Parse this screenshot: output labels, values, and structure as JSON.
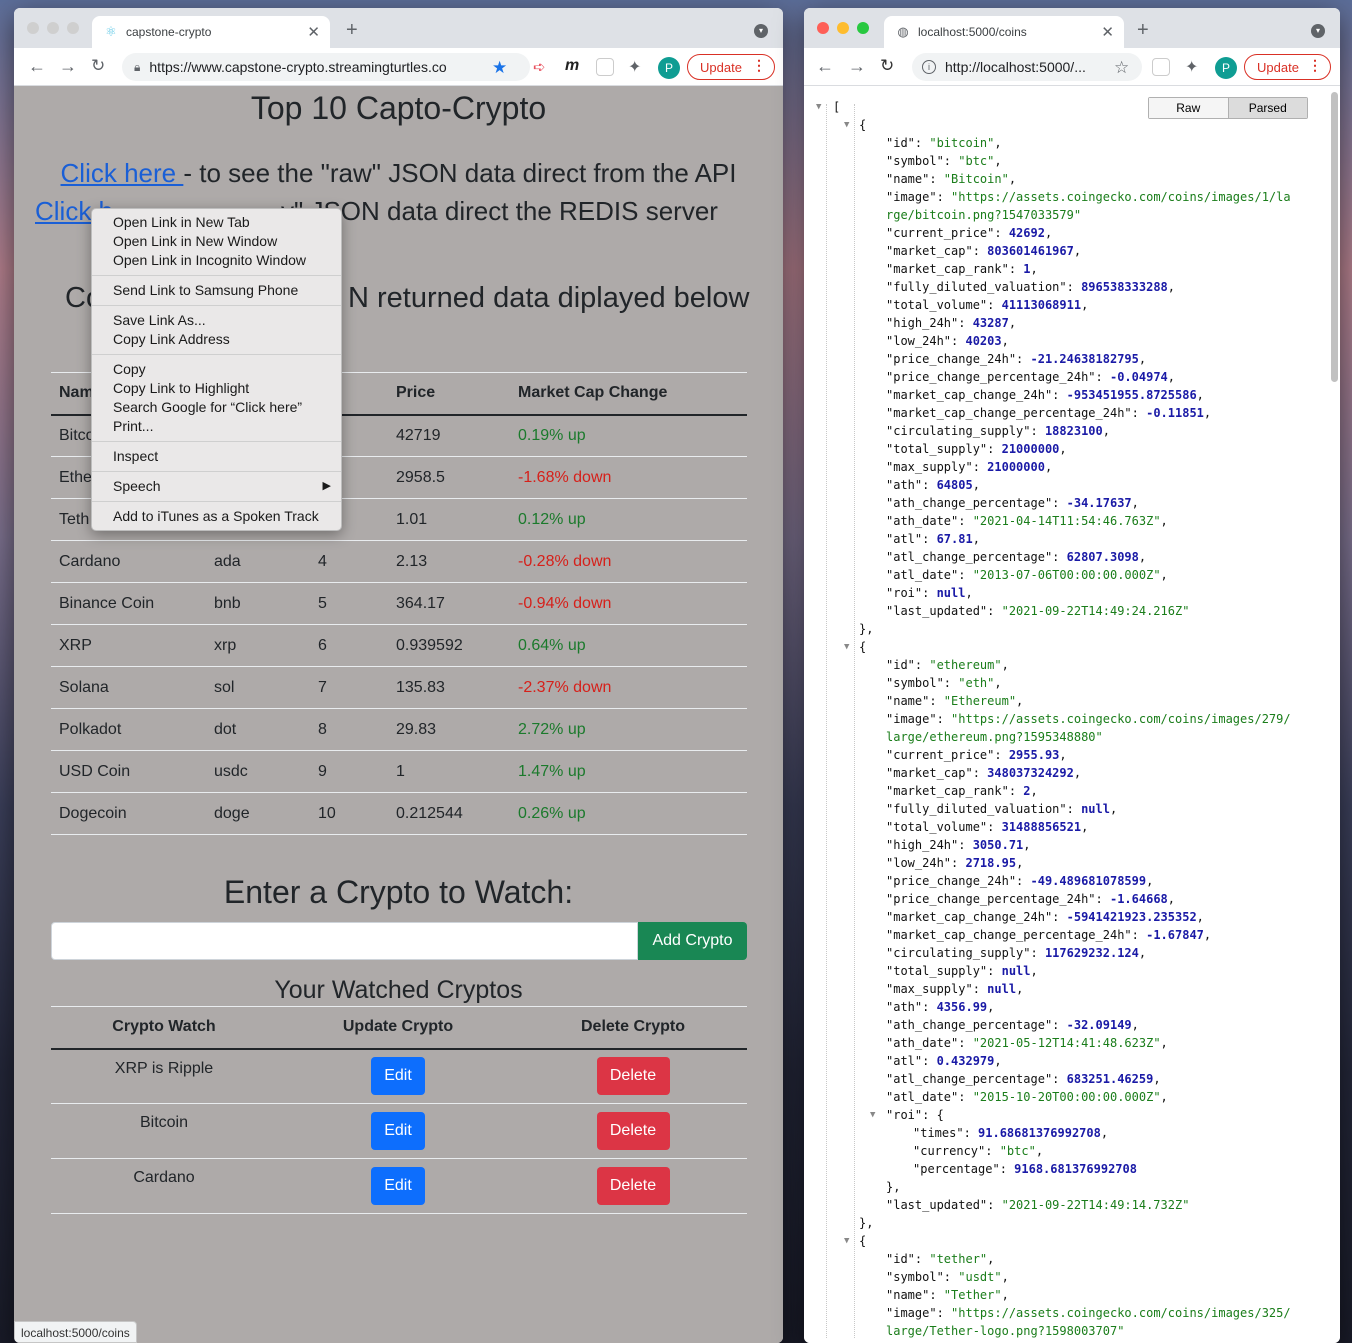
{
  "left_window": {
    "tab_title": "capstone-crypto",
    "url": "https://www.capstone-crypto.streamingturtles.co",
    "update_label": "Update",
    "avatar_letter": "P",
    "page": {
      "title": "Top 10 Capto-Crypto",
      "link1_text": "Click here ",
      "link1_rest": "- to see the \"raw\" JSON data direct from the API",
      "link2_text": "Click h",
      "link2_rest": "y\" JSON data direct the REDIS server",
      "subtitle_left": "Co",
      "subtitle_right": "N returned data diplayed below",
      "market_headers": [
        "Nam",
        "nk",
        "Price",
        "Market Cap Change"
      ],
      "market_rows": [
        {
          "name": "Bitco",
          "symbol": "",
          "rank": "",
          "price": "42719",
          "change": "0.19% up",
          "dir": "up"
        },
        {
          "name": "Ethe",
          "symbol": "",
          "rank": "",
          "price": "2958.5",
          "change": "-1.68% down",
          "dir": "down"
        },
        {
          "name": "Teth",
          "symbol": "",
          "rank": "",
          "price": "1.01",
          "change": "0.12% up",
          "dir": "up"
        },
        {
          "name": "Cardano",
          "symbol": "ada",
          "rank": "4",
          "price": "2.13",
          "change": "-0.28% down",
          "dir": "down"
        },
        {
          "name": "Binance Coin",
          "symbol": "bnb",
          "rank": "5",
          "price": "364.17",
          "change": "-0.94% down",
          "dir": "down"
        },
        {
          "name": "XRP",
          "symbol": "xrp",
          "rank": "6",
          "price": "0.939592",
          "change": "0.64% up",
          "dir": "up"
        },
        {
          "name": "Solana",
          "symbol": "sol",
          "rank": "7",
          "price": "135.83",
          "change": "-2.37% down",
          "dir": "down"
        },
        {
          "name": "Polkadot",
          "symbol": "dot",
          "rank": "8",
          "price": "29.83",
          "change": "2.72% up",
          "dir": "up"
        },
        {
          "name": "USD Coin",
          "symbol": "usdc",
          "rank": "9",
          "price": "1",
          "change": "1.47% up",
          "dir": "up"
        },
        {
          "name": "Dogecoin",
          "symbol": "doge",
          "rank": "10",
          "price": "0.212544",
          "change": "0.26% up",
          "dir": "up"
        }
      ],
      "watch_heading": "Enter a Crypto to Watch:",
      "add_input_value": "",
      "add_button": "Add Crypto",
      "watched_heading": "Your Watched Cryptos",
      "watch_headers": [
        "Crypto Watch",
        "Update Crypto",
        "Delete Crypto"
      ],
      "watch_rows": [
        {
          "name": "XRP is Ripple",
          "edit": "Edit",
          "delete": "Delete"
        },
        {
          "name": "Bitcoin",
          "edit": "Edit",
          "delete": "Delete"
        },
        {
          "name": "Cardano",
          "edit": "Edit",
          "delete": "Delete"
        }
      ],
      "status_url": "localhost:5000/coins"
    },
    "context_menu": [
      [
        "Open Link in New Tab",
        "Open Link in New Window",
        "Open Link in Incognito Window"
      ],
      [
        "Send Link to Samsung Phone"
      ],
      [
        "Save Link As...",
        "Copy Link Address"
      ],
      [
        "Copy",
        "Copy Link to Highlight",
        "Search Google for “Click here”",
        "Print..."
      ],
      [
        "Inspect"
      ],
      [
        "Speech"
      ],
      [
        "Add to iTunes as a Spoken Track"
      ]
    ]
  },
  "right_window": {
    "tab_title": "localhost:5000/coins",
    "url": "http://localhost:5000/...",
    "update_label": "Update",
    "avatar_letter": "P",
    "view_toggle": {
      "raw": "Raw",
      "parsed": "Parsed"
    },
    "json_lines": [
      [
        "0",
        "[",
        "",
        "b"
      ],
      [
        "1",
        "{",
        "",
        "b"
      ],
      [
        "2",
        "\"id\": ",
        "\"bitcoin\"",
        "s"
      ],
      [
        "2",
        "\"symbol\": ",
        "\"btc\"",
        "s"
      ],
      [
        "2",
        "\"name\": ",
        "\"Bitcoin\"",
        "s"
      ],
      [
        "2",
        "\"image\": ",
        "\"https://assets.coingecko.com/coins/images/1/la",
        "s",
        "nocomma"
      ],
      [
        "2w",
        "",
        "rge/bitcoin.png?1547033579\"",
        "s"
      ],
      [
        "2",
        "\"current_price\": ",
        "42692",
        "n"
      ],
      [
        "2",
        "\"market_cap\": ",
        "803601461967",
        "n"
      ],
      [
        "2",
        "\"market_cap_rank\": ",
        "1",
        "n"
      ],
      [
        "2",
        "\"fully_diluted_valuation\": ",
        "896538333288",
        "n"
      ],
      [
        "2",
        "\"total_volume\": ",
        "41113068911",
        "n"
      ],
      [
        "2",
        "\"high_24h\": ",
        "43287",
        "n"
      ],
      [
        "2",
        "\"low_24h\": ",
        "40203",
        "n"
      ],
      [
        "2",
        "\"price_change_24h\": ",
        "-21.24638182795",
        "n"
      ],
      [
        "2",
        "\"price_change_percentage_24h\": ",
        "-0.04974",
        "n"
      ],
      [
        "2",
        "\"market_cap_change_24h\": ",
        "-953451955.8725586",
        "n"
      ],
      [
        "2",
        "\"market_cap_change_percentage_24h\": ",
        "-0.11851",
        "n"
      ],
      [
        "2",
        "\"circulating_supply\": ",
        "18823100",
        "n"
      ],
      [
        "2",
        "\"total_supply\": ",
        "21000000",
        "n"
      ],
      [
        "2",
        "\"max_supply\": ",
        "21000000",
        "n"
      ],
      [
        "2",
        "\"ath\": ",
        "64805",
        "n"
      ],
      [
        "2",
        "\"ath_change_percentage\": ",
        "-34.17637",
        "n"
      ],
      [
        "2",
        "\"ath_date\": ",
        "\"2021-04-14T11:54:46.763Z\"",
        "s"
      ],
      [
        "2",
        "\"atl\": ",
        "67.81",
        "n"
      ],
      [
        "2",
        "\"atl_change_percentage\": ",
        "62807.3098",
        "n"
      ],
      [
        "2",
        "\"atl_date\": ",
        "\"2013-07-06T00:00:00.000Z\"",
        "s"
      ],
      [
        "2",
        "\"roi\": ",
        "null",
        "n"
      ],
      [
        "2",
        "\"last_updated\": ",
        "\"2021-09-22T14:49:24.216Z\"",
        "s",
        "nocomma"
      ],
      [
        "1",
        "},",
        "",
        "b"
      ],
      [
        "1",
        "{",
        "",
        "b"
      ],
      [
        "2",
        "\"id\": ",
        "\"ethereum\"",
        "s"
      ],
      [
        "2",
        "\"symbol\": ",
        "\"eth\"",
        "s"
      ],
      [
        "2",
        "\"name\": ",
        "\"Ethereum\"",
        "s"
      ],
      [
        "2",
        "\"image\": ",
        "\"https://assets.coingecko.com/coins/images/279/",
        "s",
        "nocomma"
      ],
      [
        "2w",
        "",
        "large/ethereum.png?1595348880\"",
        "s"
      ],
      [
        "2",
        "\"current_price\": ",
        "2955.93",
        "n"
      ],
      [
        "2",
        "\"market_cap\": ",
        "348037324292",
        "n"
      ],
      [
        "2",
        "\"market_cap_rank\": ",
        "2",
        "n"
      ],
      [
        "2",
        "\"fully_diluted_valuation\": ",
        "null",
        "n"
      ],
      [
        "2",
        "\"total_volume\": ",
        "31488856521",
        "n"
      ],
      [
        "2",
        "\"high_24h\": ",
        "3050.71",
        "n"
      ],
      [
        "2",
        "\"low_24h\": ",
        "2718.95",
        "n"
      ],
      [
        "2",
        "\"price_change_24h\": ",
        "-49.489681078599",
        "n"
      ],
      [
        "2",
        "\"price_change_percentage_24h\": ",
        "-1.64668",
        "n"
      ],
      [
        "2",
        "\"market_cap_change_24h\": ",
        "-5941421923.235352",
        "n"
      ],
      [
        "2",
        "\"market_cap_change_percentage_24h\": ",
        "-1.67847",
        "n"
      ],
      [
        "2",
        "\"circulating_supply\": ",
        "117629232.124",
        "n"
      ],
      [
        "2",
        "\"total_supply\": ",
        "null",
        "n"
      ],
      [
        "2",
        "\"max_supply\": ",
        "null",
        "n"
      ],
      [
        "2",
        "\"ath\": ",
        "4356.99",
        "n"
      ],
      [
        "2",
        "\"ath_change_percentage\": ",
        "-32.09149",
        "n"
      ],
      [
        "2",
        "\"ath_date\": ",
        "\"2021-05-12T14:41:48.623Z\"",
        "s"
      ],
      [
        "2",
        "\"atl\": ",
        "0.432979",
        "n"
      ],
      [
        "2",
        "\"atl_change_percentage\": ",
        "683251.46259",
        "n"
      ],
      [
        "2",
        "\"atl_date\": ",
        "\"2015-10-20T00:00:00.000Z\"",
        "s"
      ],
      [
        "2t",
        "\"roi\": {",
        "",
        "b"
      ],
      [
        "3",
        "\"times\": ",
        "91.68681376992708",
        "n"
      ],
      [
        "3",
        "\"currency\": ",
        "\"btc\"",
        "s"
      ],
      [
        "3",
        "\"percentage\": ",
        "9168.681376992708",
        "n",
        "nocomma"
      ],
      [
        "2",
        "},",
        "",
        "b"
      ],
      [
        "2",
        "\"last_updated\": ",
        "\"2021-09-22T14:49:14.732Z\"",
        "s",
        "nocomma"
      ],
      [
        "1",
        "},",
        "",
        "b"
      ],
      [
        "1",
        "{",
        "",
        "b"
      ],
      [
        "2",
        "\"id\": ",
        "\"tether\"",
        "s"
      ],
      [
        "2",
        "\"symbol\": ",
        "\"usdt\"",
        "s"
      ],
      [
        "2",
        "\"name\": ",
        "\"Tether\"",
        "s"
      ],
      [
        "2",
        "\"image\": ",
        "\"https://assets.coingecko.com/coins/images/325/",
        "s",
        "nocomma"
      ],
      [
        "2w",
        "",
        "large/Tether-logo.png?1598003707\"",
        "s"
      ]
    ]
  }
}
